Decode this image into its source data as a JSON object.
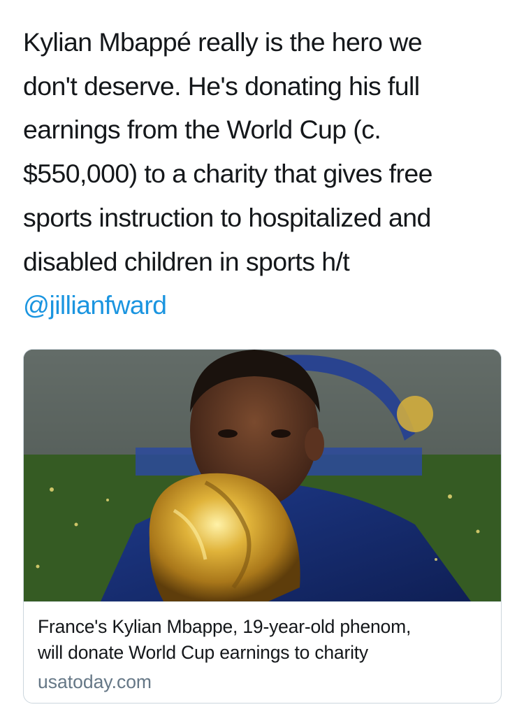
{
  "tweet": {
    "text_lines": [
      "Kylian Mbappé really is the hero we",
      "don't deserve. He's donating his full",
      "earnings from the World Cup (c.",
      "$550,000) to a charity that gives free",
      "sports instruction to hospitalized and",
      "disabled children in sports h/t"
    ],
    "mention": "@jillianfward"
  },
  "card": {
    "title_line_1": "France's Kylian Mbappe, 19-year-old phenom,",
    "title_line_2": "will donate World Cup earnings to charity",
    "domain": "usatoday.com",
    "image_description_icon": "photo-image"
  },
  "colors": {
    "text": "#14171a",
    "link": "#1b95e0",
    "secondary": "#657786",
    "border": "#ccd6dd"
  }
}
